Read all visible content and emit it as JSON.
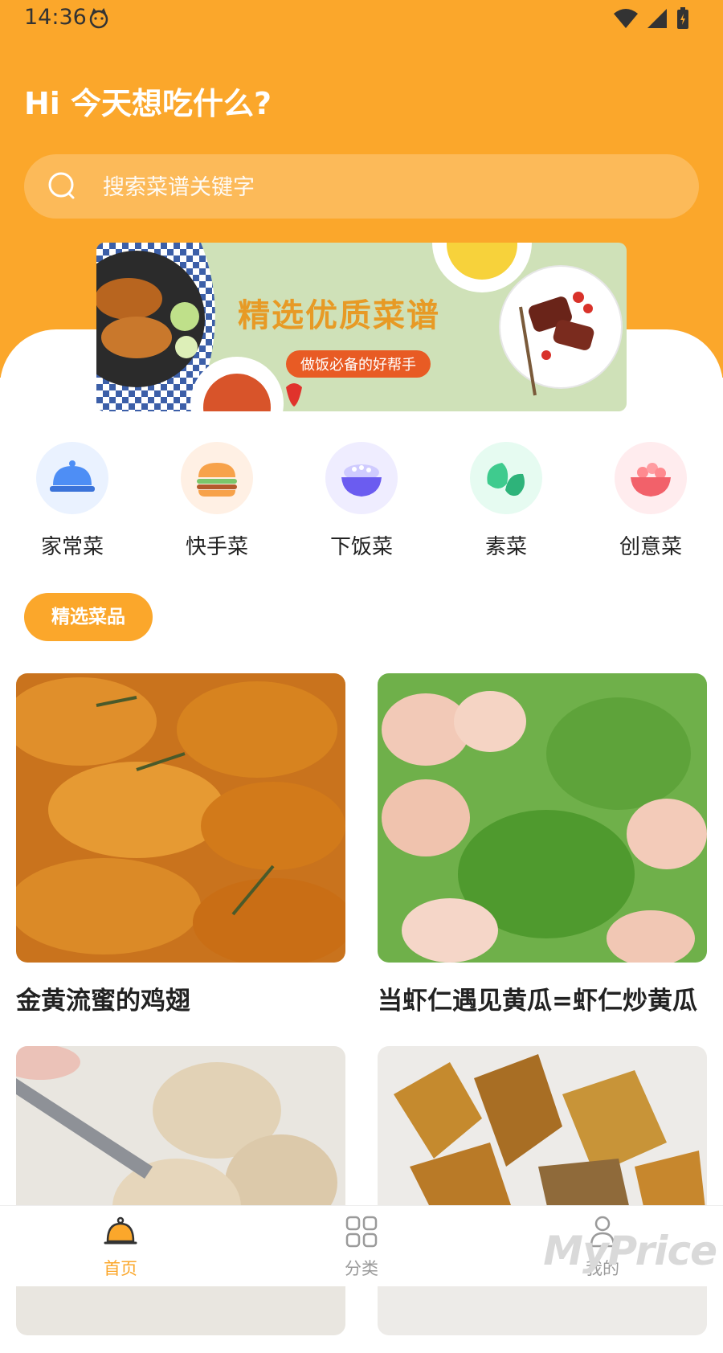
{
  "status": {
    "time": "14:36"
  },
  "header": {
    "greeting": "Hi 今天想吃什么?"
  },
  "search": {
    "placeholder": "搜索菜谱关键字"
  },
  "banner": {
    "title": "精选优质菜谱",
    "subtitle": "做饭必备的好帮手"
  },
  "categories": [
    {
      "label": "家常菜",
      "icon": "cloche-icon",
      "bg": "#EAF2FF"
    },
    {
      "label": "快手菜",
      "icon": "burger-icon",
      "bg": "#FFF0E4"
    },
    {
      "label": "下饭菜",
      "icon": "rice-bowl-icon",
      "bg": "#EFEDFF"
    },
    {
      "label": "素菜",
      "icon": "vegetable-icon",
      "bg": "#E6FBF1"
    },
    {
      "label": "创意菜",
      "icon": "salad-icon",
      "bg": "#FFECEE"
    }
  ],
  "section": {
    "title": "精选菜品"
  },
  "recipes": [
    {
      "title": "金黄流蜜的鸡翅"
    },
    {
      "title": "当虾仁遇见黄瓜=虾仁炒黄瓜"
    },
    {
      "title": ""
    },
    {
      "title": ""
    }
  ],
  "nav": [
    {
      "label": "首页",
      "icon": "home-cloche-icon",
      "active": true
    },
    {
      "label": "分类",
      "icon": "grid-icon",
      "active": false
    },
    {
      "label": "我的",
      "icon": "profile-icon",
      "active": false
    }
  ],
  "watermark": "MyPrice",
  "colors": {
    "accent": "#FBA72B",
    "bannerAccent": "#E85B24"
  }
}
